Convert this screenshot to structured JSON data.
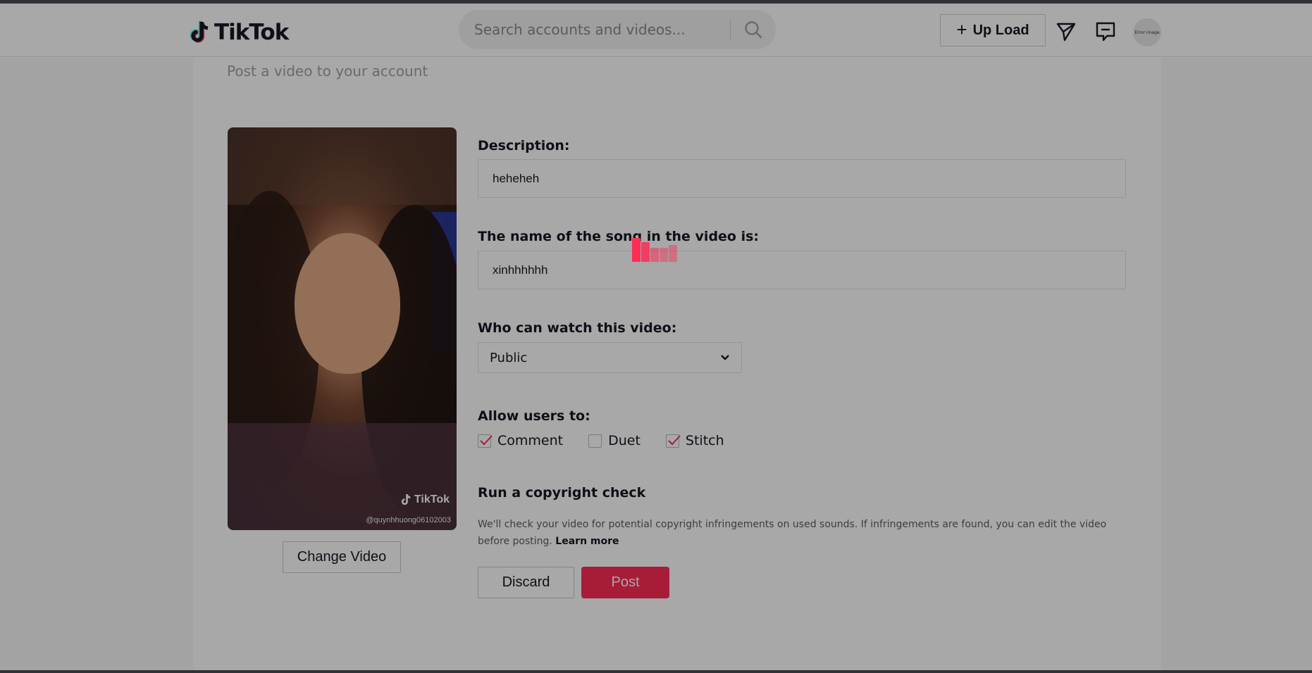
{
  "header": {
    "logo_text": "TikTok",
    "search_placeholder": "Search accounts and videos...",
    "upload_label": "Up Load",
    "avatar_alt": "Error image"
  },
  "page": {
    "subtitle": "Post a video to your account"
  },
  "video": {
    "watermark": "TikTok",
    "username": "@quynhhuong06102003",
    "change_label": "Change Video"
  },
  "form": {
    "description_label": "Description:",
    "description_value": "heheheh",
    "song_label": "The name of the song in the video is:",
    "song_value": "xinhhhhhh",
    "privacy_label": "Who can watch this video:",
    "privacy_value": "Public",
    "allow_label": "Allow users to:",
    "allow_options": [
      {
        "label": "Comment",
        "checked": true
      },
      {
        "label": "Duet",
        "checked": false
      },
      {
        "label": "Stitch",
        "checked": true
      }
    ],
    "copyright_title": "Run a copyright check",
    "copyright_desc": "We'll check your video for potential copyright infringements on used sounds. If infringements are found, you can edit the video before posting.",
    "learn_more": "Learn more",
    "discard_label": "Discard",
    "post_label": "Post"
  },
  "colors": {
    "accent": "#fe2c55",
    "overlay": "rgba(0,0,0,0.34)"
  },
  "icons": [
    "tiktok-logo-icon",
    "search-icon",
    "plus-icon",
    "send-icon",
    "message-icon",
    "chevron-down-icon",
    "check-icon",
    "loading-spinner-icon"
  ]
}
